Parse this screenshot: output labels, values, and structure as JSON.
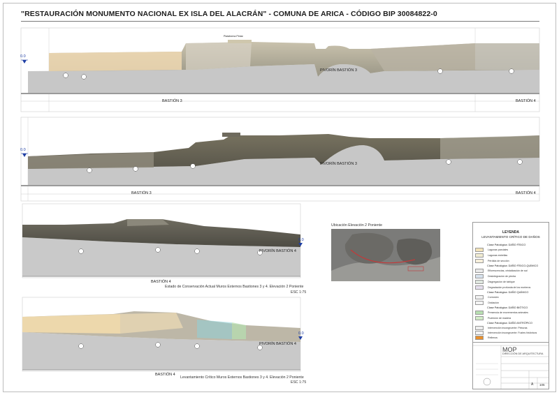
{
  "title": "\"RESTAURACIÓN MONUMENTO NACIONAL EX ISLA DEL ALACRÁN\" - COMUNA DE ARICA - CÓDIGO BIP 30084822-0",
  "elevation_1": {
    "left_label": "BASTIÓN 3",
    "right_label": "BASTIÓN 4",
    "center_label": "PIVORÍN BASTIÓN 3",
    "level_marker": "0.0",
    "note_label": "Plataforma Pintar"
  },
  "elevation_2": {
    "left_label": "BASTIÓN 3",
    "right_label": "BASTIÓN 4",
    "center_label": "PIVORÍN BASTIÓN 3",
    "level_marker": "0.0"
  },
  "elevation_3": {
    "left_label": "BASTIÓN 4",
    "center_label": "PIVORÍN BASTIÓN 4",
    "level_marker": "0.0",
    "caption": "Estado de Conservación Actual Muros Externos Bastiones 3 y 4. Elevación 2  Poniente",
    "scale": "ESC 1:75"
  },
  "elevation_4": {
    "left_label": "BASTIÓN 4",
    "center_label": "PIVORÍN BASTIÓN 4",
    "level_marker": "0.0",
    "caption": "Levantamiento Crítico Muros Externos Bastiones 3 y 4. Elevación 2  Poniente",
    "scale": "ESC 1:75"
  },
  "location_inset": {
    "title": "Ubicación Elevación 2 Poniente"
  },
  "legend": {
    "heading": "LEYENDA",
    "subheading": "LEVANTAMIENTO CRÍTICO DE DAÑOS",
    "groups": [
      {
        "label": "Clase Patológica: DAÑO FÍSICO"
      },
      {
        "label": "Clase Patológica: DAÑO FÍSICO-QUÍMICO"
      },
      {
        "label": "Clase Patológica: DAÑO QUÍMICO"
      },
      {
        "label": "Clase Patológica: DAÑO BIÓTICO"
      },
      {
        "label": "Clase Patológica: DAÑO ANTRÓPICO"
      }
    ],
    "items": [
      {
        "code": "LP",
        "text": "Lagunas parciales",
        "color": "#f3e3b8"
      },
      {
        "code": "LE",
        "text": "Lagunas estrellas",
        "color": "#f1ecd2"
      },
      {
        "code": "PE",
        "text": "Pérdida de sección",
        "color": "#f7f0dc"
      },
      {
        "code": "E",
        "text": "Eflorescencias, cristalización de sal",
        "color": "#e9e9e9"
      },
      {
        "code": "DE",
        "text": "Desintegración de piedra",
        "color": "#d8e3ef"
      },
      {
        "code": "DS",
        "text": "Disgregación de tabique",
        "color": "#dfe7df"
      },
      {
        "code": "DM",
        "text": "Degradación profunda de los morteros",
        "color": "#e6e0ef"
      },
      {
        "code": "CO",
        "text": "Corrosión",
        "color": "#f0f0f0"
      },
      {
        "code": "OX",
        "text": "Oxidación",
        "color": "#f4f4f4"
      },
      {
        "code": "EX",
        "text": "Presencia de excrementos animales",
        "color": "#b7dfb0"
      },
      {
        "code": "PM",
        "text": "Pudrición de madera",
        "color": "#d3ecc8"
      },
      {
        "code": "A1",
        "text": "Intervención incongruente: Pinturas",
        "color": "#eeeeee"
      },
      {
        "code": "A2",
        "text": "Intervención incongruente: Fustes históricos",
        "color": "#f3f3f3"
      },
      {
        "code": "A3",
        "text": "Intervención incongruente: No pertinentes con criterios",
        "color": "#f6f6f6"
      },
      {
        "code": "A4",
        "text": "Rellenos",
        "color": "#e8902e"
      }
    ]
  },
  "title_block": {
    "org": "MOP",
    "dept": "DIRECCIÓN DE ARQUITECTURA",
    "sheet_code": "A",
    "sheet_number": "105"
  }
}
